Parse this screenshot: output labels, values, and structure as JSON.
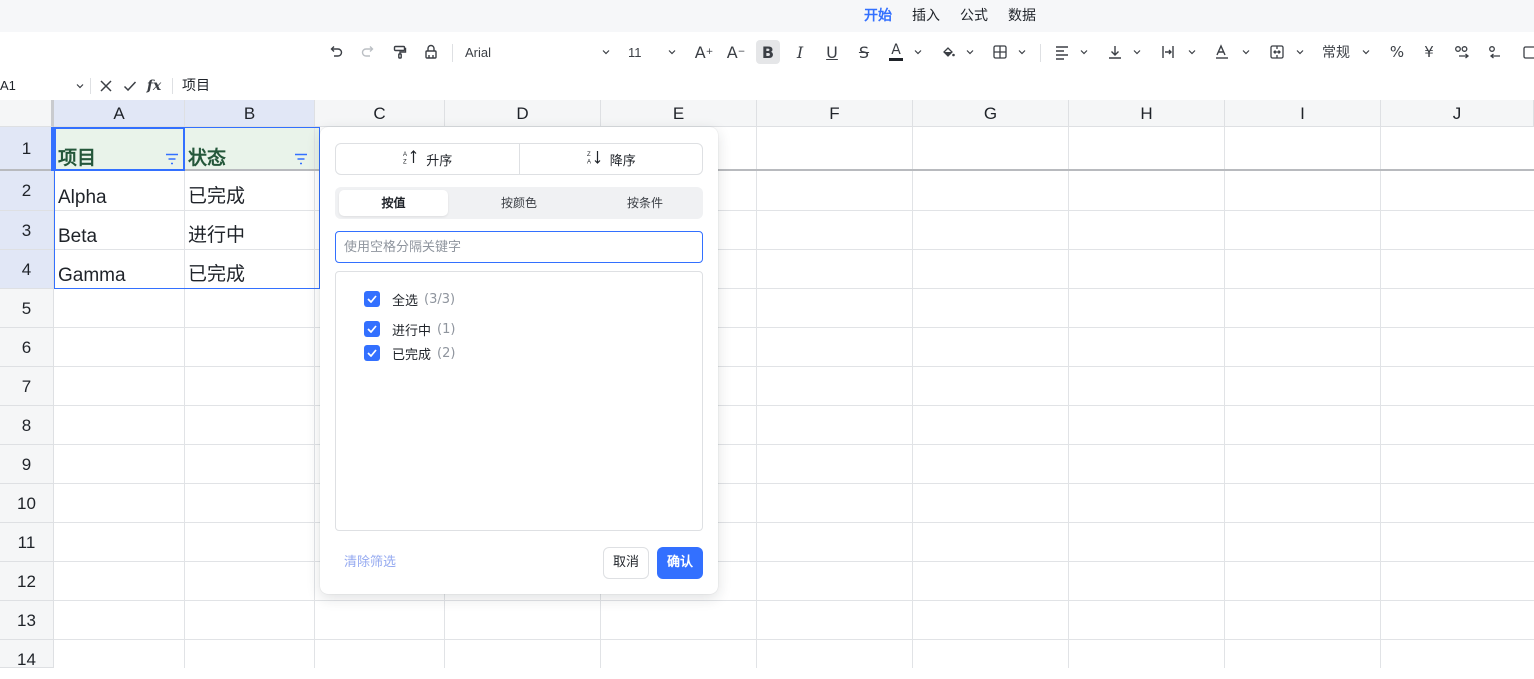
{
  "menu": {
    "tabs": [
      {
        "label": "开始",
        "active": true
      },
      {
        "label": "插入",
        "active": false
      },
      {
        "label": "公式",
        "active": false
      },
      {
        "label": "数据",
        "active": false
      }
    ]
  },
  "toolbar": {
    "font_name": "Arial",
    "font_size": "11",
    "number_format": "常规",
    "font_color": "#1f2329",
    "fill_color_swatch": "#3370ff",
    "icons": [
      "undo-icon",
      "redo-icon",
      "format-painter-icon",
      "clear-format-icon",
      "increase-font-icon",
      "decrease-font-icon",
      "bold-icon",
      "italic-icon",
      "underline-icon",
      "strikethrough-icon",
      "font-color-icon",
      "fill-color-icon",
      "borders-icon",
      "horizontal-align-icon",
      "vertical-align-icon",
      "text-wrap-icon",
      "text-rotate-icon",
      "merge-cells-icon",
      "percent-icon",
      "currency-icon",
      "increase-decimal-icon",
      "decrease-decimal-icon"
    ]
  },
  "formula_bar": {
    "cell_ref": "A1",
    "fx_label": "fx",
    "content": "项目"
  },
  "grid": {
    "columns": [
      "A",
      "B",
      "C",
      "D",
      "E",
      "F",
      "G",
      "H",
      "I",
      "J"
    ],
    "rows": [
      "1",
      "2",
      "3",
      "4",
      "5",
      "6",
      "7",
      "8",
      "9",
      "10",
      "11",
      "12",
      "13",
      "14"
    ],
    "header_row": [
      "项目",
      "状态"
    ],
    "data_rows": [
      [
        "Alpha",
        "已完成"
      ],
      [
        "Beta",
        "进行中"
      ],
      [
        "Gamma",
        "已完成"
      ]
    ],
    "selection_color": "#3370ff",
    "header_fill": "#e9f3ea",
    "header_text_color": "#24573a"
  },
  "filter_popup": {
    "sort_asc": "升序",
    "sort_desc": "降序",
    "tabs": [
      {
        "label": "按值",
        "active": true
      },
      {
        "label": "按颜色",
        "active": false
      },
      {
        "label": "按条件",
        "active": false
      }
    ],
    "search_placeholder": "使用空格分隔关键字",
    "select_all": {
      "label": "全选",
      "count": "(3/3)",
      "checked": true
    },
    "values": [
      {
        "label": "进行中",
        "count": "(1)",
        "checked": true
      },
      {
        "label": "已完成",
        "count": "(2)",
        "checked": true
      }
    ],
    "clear_label": "清除筛选",
    "cancel_label": "取消",
    "confirm_label": "确认",
    "accent_color": "#3370ff"
  }
}
